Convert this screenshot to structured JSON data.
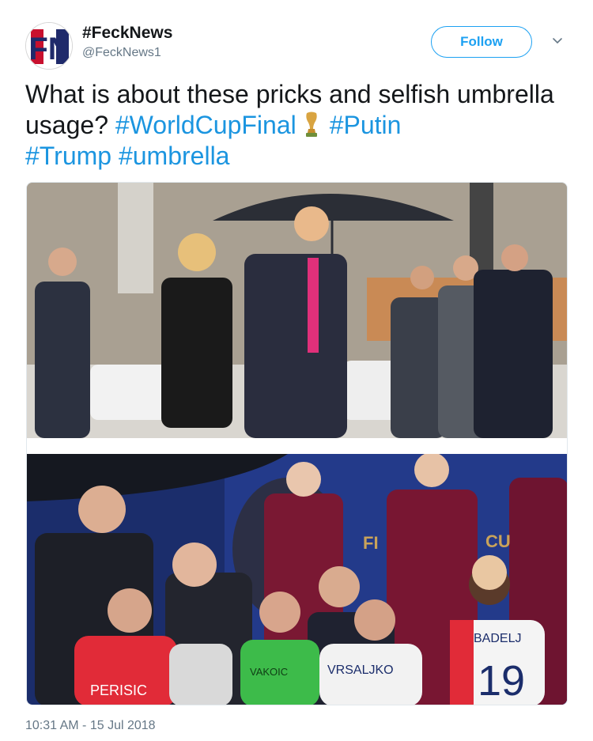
{
  "author": {
    "avatar_letters": "FN",
    "display_name": "#FeckNews",
    "handle": "@FeckNews1"
  },
  "actions": {
    "follow_label": "Follow",
    "more_icon": "chevron-down-icon"
  },
  "tweet": {
    "text_part1": "What is about these pricks and selfish umbrella usage? ",
    "hashtags": [
      "#WorldCupFinal",
      "#Putin",
      "#Trump",
      "#umbrella"
    ],
    "emoji_icon": "trophy-icon"
  },
  "media": {
    "photo_top_icon": "photo",
    "photo_bottom_jersey_names": [
      "PERISIC",
      "VRSALJKO",
      "BADELJ",
      "VAKOIC"
    ],
    "photo_bottom_jersey_number": "19",
    "photo_bottom_backdrop_letters": [
      "FI",
      "CU"
    ]
  },
  "timestamp": "10:31 AM - 15 Jul 2018",
  "colors": {
    "link": "#1b95e0",
    "follow_border": "#1da1f2",
    "secondary_text": "#657786"
  }
}
